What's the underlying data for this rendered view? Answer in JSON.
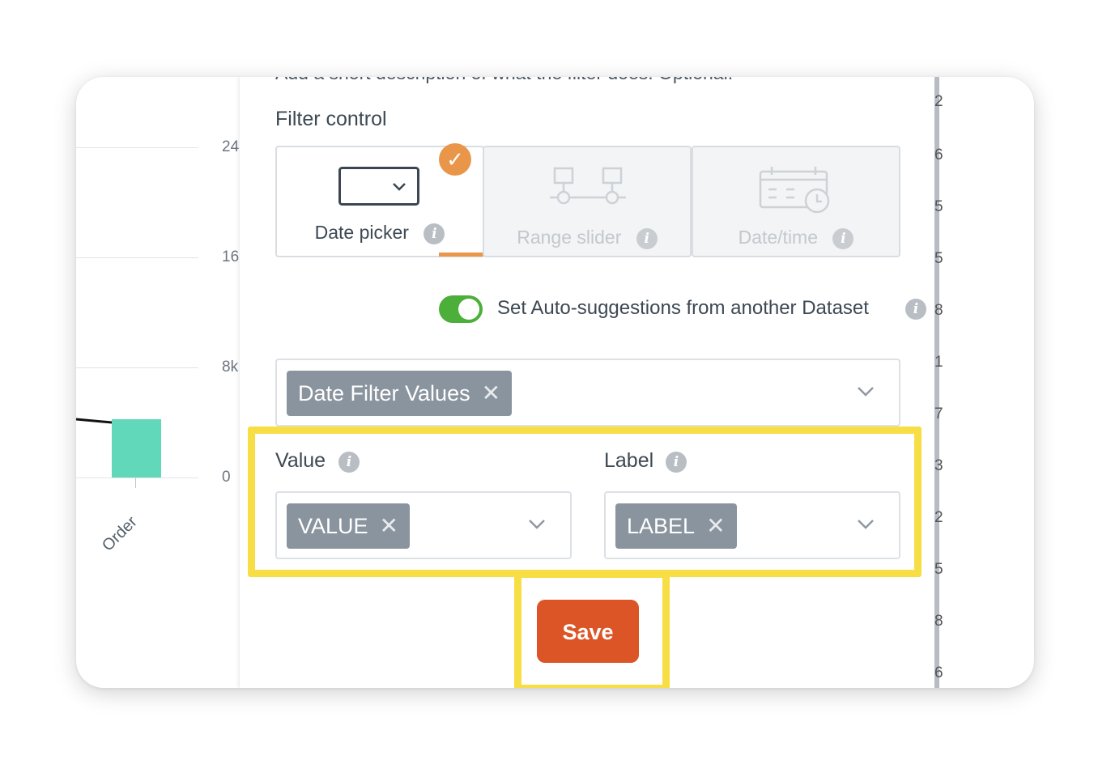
{
  "chart_background": {
    "y_ticks": [
      "24",
      "16",
      "8k",
      "0"
    ],
    "x_label": "Order",
    "bar_color": "#62d8bb",
    "right_fragments": [
      "2",
      "6",
      "5",
      "5",
      "8",
      "1",
      "7",
      "3",
      "2",
      "5",
      "8",
      "6"
    ]
  },
  "modal": {
    "description_hint": "Add a short description of what the filter does. Optional.",
    "filter_control_label": "Filter control",
    "controls": [
      {
        "label": "Date picker",
        "selected": true,
        "icon": "dropdown-icon"
      },
      {
        "label": "Range slider",
        "selected": false,
        "icon": "range-slider-icon"
      },
      {
        "label": "Date/time",
        "selected": false,
        "icon": "calendar-clock-icon"
      }
    ],
    "auto_suggest_label": "Set Auto-suggestions from another Dataset",
    "auto_suggest_enabled": true,
    "dataset_chip": "Date Filter Values",
    "value_label": "Value",
    "value_chip": "VALUE",
    "label_label": "Label",
    "label_chip": "LABEL",
    "save_label": "Save",
    "colors": {
      "accent_orange": "#e9964a",
      "toggle_green": "#4caf3a",
      "save_red": "#db5526",
      "highlight_yellow": "#f7de45",
      "chip_gray": "#8a949e"
    }
  }
}
